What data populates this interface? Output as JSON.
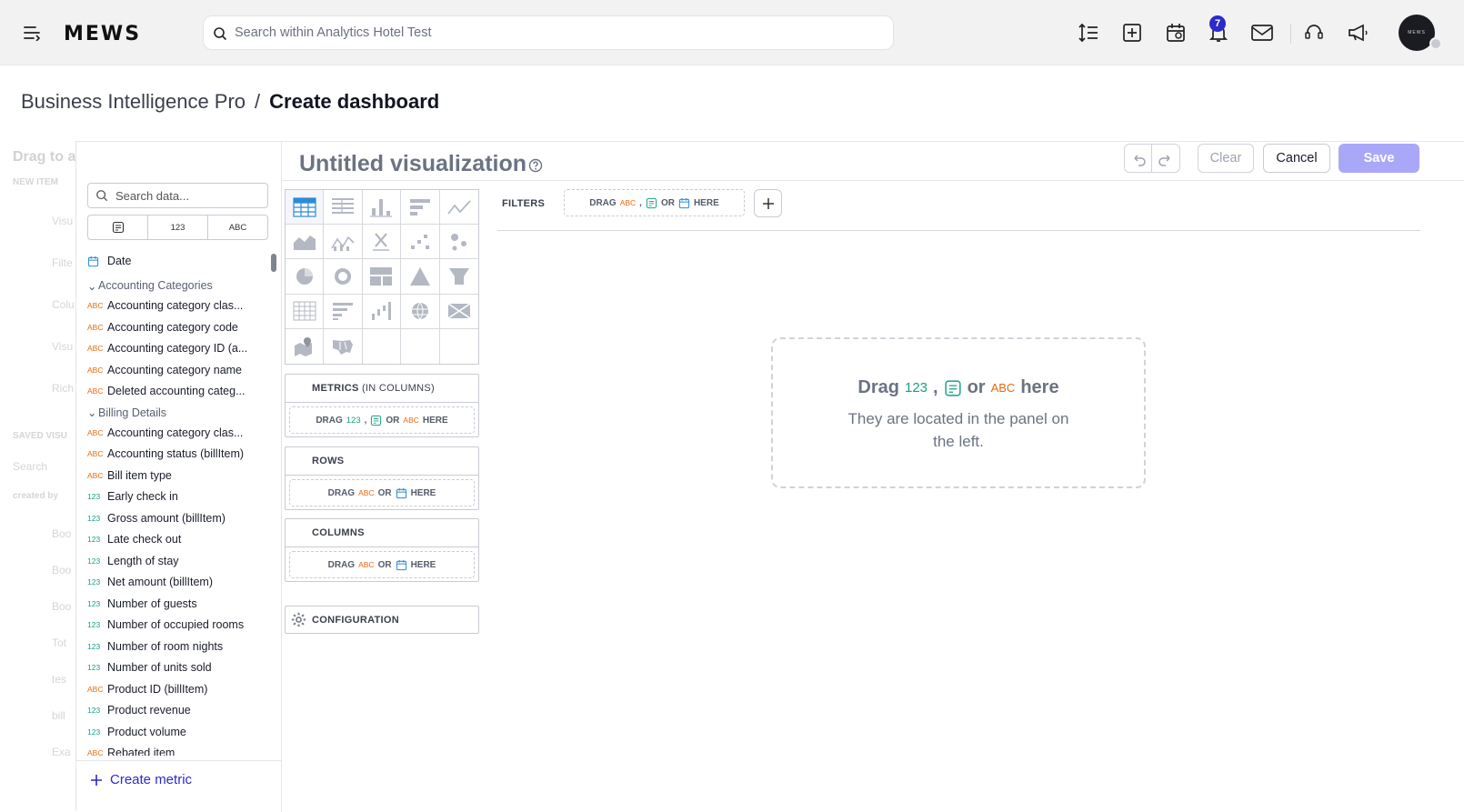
{
  "app": {
    "logo": "MEWS",
    "search_placeholder": "Search within Analytics Hotel Test",
    "notification_count": "7",
    "avatar_text": "MEWS",
    "toolbar_icons": [
      "sort-lines-icon",
      "add-box-icon",
      "calendar-icon",
      "bell-icon",
      "mail-icon",
      "support-icon",
      "megaphone-icon"
    ]
  },
  "breadcrumb": {
    "parent": "Business Intelligence Pro",
    "separator": "/",
    "current": "Create dashboard"
  },
  "background_panel": {
    "title": "Drag to a",
    "new_item": "NEW ITEM",
    "items": [
      "Visu",
      "Filte",
      "Colu",
      "Visu",
      "Rich"
    ],
    "saved": "SAVED VISU",
    "search": "Search",
    "created_by": "created by",
    "list": [
      "Boo",
      "Boo",
      "Boo",
      "Tot",
      "tes",
      "bill",
      "Exa"
    ]
  },
  "visualization": {
    "title": "Untitled visualization",
    "clear": "Clear",
    "cancel": "Cancel",
    "save": "Save"
  },
  "data_panel": {
    "search_placeholder": "Search data...",
    "filter_tabs": [
      "date",
      "123",
      "ABC"
    ],
    "create_metric": "Create metric",
    "items": [
      {
        "type": "date",
        "label": "Date"
      },
      {
        "type": "group",
        "label": "Accounting Categories"
      },
      {
        "type": "ABC",
        "label": "Accounting category clas..."
      },
      {
        "type": "ABC",
        "label": "Accounting category code"
      },
      {
        "type": "ABC",
        "label": "Accounting category ID (a..."
      },
      {
        "type": "ABC",
        "label": "Accounting category name"
      },
      {
        "type": "ABC",
        "label": "Deleted accounting categ..."
      },
      {
        "type": "group",
        "label": "Billing Details"
      },
      {
        "type": "ABC",
        "label": "Accounting category clas..."
      },
      {
        "type": "ABC",
        "label": "Accounting status (billItem)"
      },
      {
        "type": "ABC",
        "label": "Bill item type"
      },
      {
        "type": "123",
        "label": "Early check in"
      },
      {
        "type": "123",
        "label": "Gross amount (billItem)"
      },
      {
        "type": "123",
        "label": "Late check out"
      },
      {
        "type": "123",
        "label": "Length of stay"
      },
      {
        "type": "123",
        "label": "Net amount (billItem)"
      },
      {
        "type": "123",
        "label": "Number of guests"
      },
      {
        "type": "123",
        "label": "Number of occupied rooms"
      },
      {
        "type": "123",
        "label": "Number of room nights"
      },
      {
        "type": "123",
        "label": "Number of units sold"
      },
      {
        "type": "ABC",
        "label": "Product ID (billItem)"
      },
      {
        "type": "123",
        "label": "Product revenue"
      },
      {
        "type": "123",
        "label": "Product volume"
      },
      {
        "type": "ABC",
        "label": "Rebated item"
      }
    ]
  },
  "sections": {
    "metrics_label": "METRICS",
    "metrics_sub": "(IN COLUMNS)",
    "rows_label": "ROWS",
    "columns_label": "COLUMNS",
    "configuration_label": "CONFIGURATION",
    "drag": "DRAG",
    "or": "OR",
    "here": "HERE",
    "comma": ",",
    "num": "123",
    "abc": "ABC"
  },
  "filters": {
    "label": "FILTERS"
  },
  "canvas": {
    "drag": "Drag",
    "or": "or",
    "here": "here",
    "hint": "They are located in the panel on the left."
  },
  "colors": {
    "accent": "#2a2acc",
    "save_button": "#a9a8f8",
    "abc": "#e76b10",
    "number": "#18a085"
  }
}
